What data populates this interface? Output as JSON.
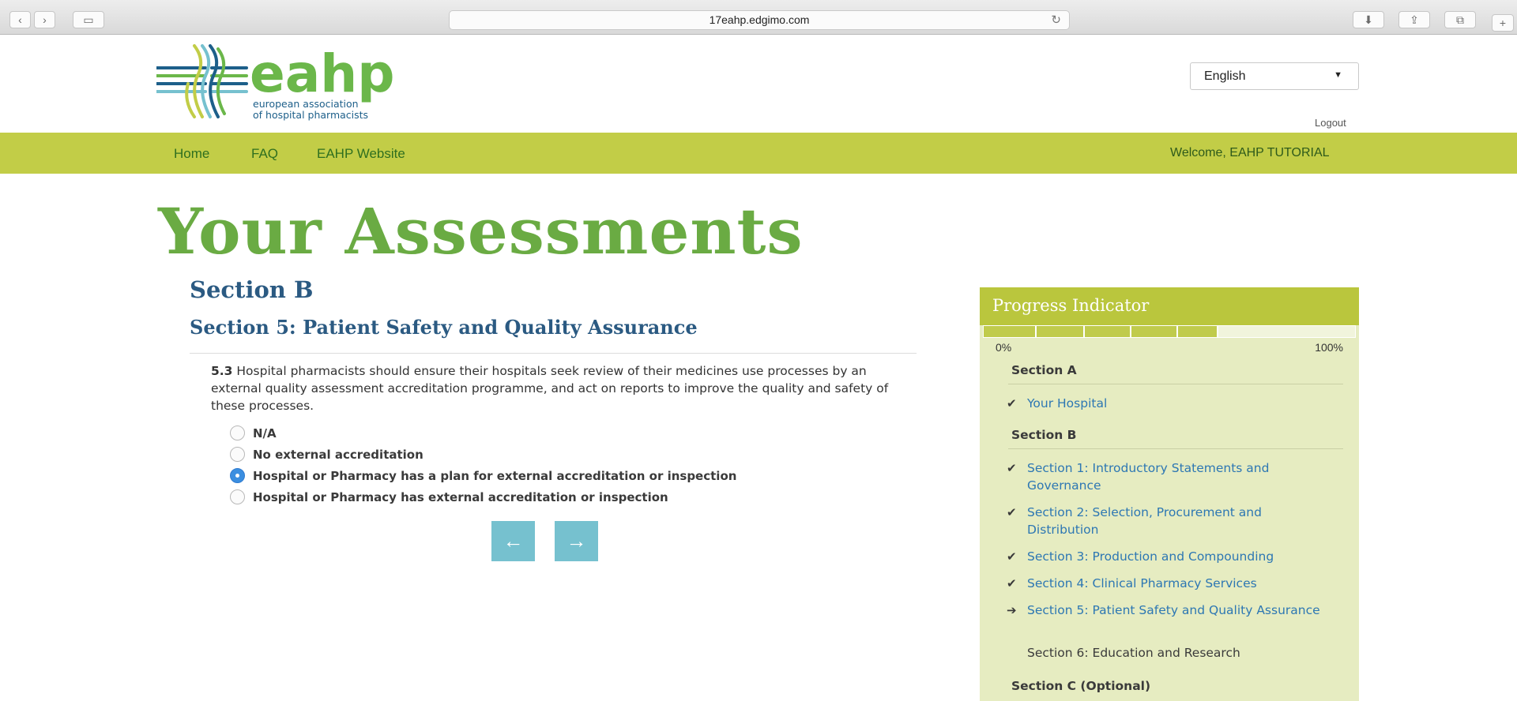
{
  "browser": {
    "url": "17eahp.edgimo.com",
    "back_icon": "chevron-left-icon",
    "forward_icon": "chevron-right-icon"
  },
  "header": {
    "logo_word": "eahp",
    "logo_line1": "european association",
    "logo_line2": "of hospital pharmacists",
    "language_selected": "English",
    "logout": "Logout"
  },
  "nav": {
    "home": "Home",
    "faq": "FAQ",
    "website": "EAHP Website",
    "welcome": "Welcome, EAHP TUTORIAL"
  },
  "page": {
    "title": "Your Assessments",
    "section": "Section B",
    "subsection": "Section 5: Patient Safety and Quality Assurance",
    "question_number": "5.3",
    "question_text": "Hospital pharmacists should ensure their hospitals seek review of their medicines use processes by an external quality assessment accreditation programme, and act on reports to improve the quality and safety of these processes.",
    "options": [
      {
        "label": "N/A",
        "selected": false
      },
      {
        "label": "No external accreditation",
        "selected": false
      },
      {
        "label": "Hospital or Pharmacy has a plan for external accreditation or inspection",
        "selected": true
      },
      {
        "label": "Hospital or Pharmacy has external accreditation or inspection",
        "selected": false
      }
    ],
    "prev_icon": "arrow-left-icon",
    "next_icon": "arrow-right-icon"
  },
  "progress": {
    "title": "Progress Indicator",
    "min_label": "0%",
    "max_label": "100%",
    "fraction_complete": 0.7,
    "section_a": "Section A",
    "your_hospital": "Your Hospital",
    "section_b": "Section B",
    "items": [
      {
        "label": "Section 1: Introductory Statements and Governance",
        "status": "done"
      },
      {
        "label": "Section 2: Selection, Procurement and Distribution",
        "status": "done"
      },
      {
        "label": "Section 3: Production and Compounding",
        "status": "done"
      },
      {
        "label": "Section 4: Clinical Pharmacy Services",
        "status": "done"
      },
      {
        "label": "Section 5: Patient Safety and Quality Assurance",
        "status": "current"
      },
      {
        "label": "Section 6: Education and Research",
        "status": "todo"
      }
    ],
    "section_c": "Section C (Optional)"
  },
  "colors": {
    "navbar": "#c2cd47",
    "title_green": "#6aab43",
    "heading_blue": "#2b5a82",
    "link_blue": "#2d77b3",
    "button_teal": "#76c1cf",
    "panel_bg": "#e6ecc1"
  }
}
